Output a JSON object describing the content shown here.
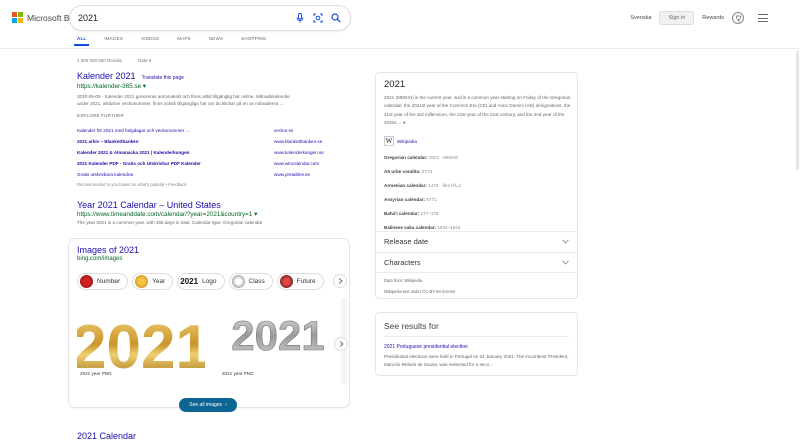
{
  "header": {
    "logo_text": "Microsoft Bing",
    "search_value": "2021",
    "language": "Svenska",
    "signin": "Sign in",
    "rewards": "Rewards"
  },
  "tabs": [
    "ALL",
    "IMAGES",
    "VIDEOS",
    "MAPS",
    "NEWS",
    "SHOPPING"
  ],
  "meta": {
    "results_count": "1 300 000 000 Results",
    "date_filter": "Date"
  },
  "result1": {
    "title": "Kalender 2021",
    "translate": "Translate this page",
    "url": "https://kalender-365.se",
    "snippet_line1": "2020-06-09 · Kalender 2021 genereras automatiskt och finns alltid tillgänglig här online. Månadskalender",
    "snippet_line2": "under 2021, inklusive veckonummer, finns också tillgängliga här om du klickar på en av månaderna ...",
    "explore_title": "EXPLORE FURTHER",
    "explore": [
      {
        "label": "Kalender för 2021 med helgdagar och veckonummer ...",
        "source": "veckor.se"
      },
      {
        "label": "2021 arkiv – Blankettbanken",
        "source": "www.blankettbanken.se"
      },
      {
        "label": "Kalender 2021 & Almanacka 2021 | Kalenderkungen",
        "source": "www.kalenderkungen.se"
      },
      {
        "label": "2021 Kalender PDF - Gratis och Utskrivbar PDF Kalender",
        "source": "www.wincalendar.com"
      },
      {
        "label": "Gratis utskrivbara kalendrar",
        "source": "www.pretables.se"
      }
    ],
    "recommended": "Recommended to you based on what's popular • Feedback"
  },
  "result2": {
    "title": "Year 2021 Calendar – United States",
    "url": "https://www.timeanddate.com/calendar/?year=2021&country=1",
    "snippet": "The year 2021 is a common year, with 365 days in total. Calendar type: Gregorian calendar"
  },
  "images": {
    "title": "Images of 2021",
    "url": "bing.com/images",
    "chips": [
      "Number",
      "Year",
      "Logo",
      "Class",
      "Future"
    ],
    "captions": [
      "2021 year PNG",
      "2021 year PNG"
    ],
    "thumb_text": "2021",
    "see_all": "See all images"
  },
  "result3": {
    "title": "2021 Calendar"
  },
  "knowledge": {
    "title": "2021",
    "body": "2021 (MMXXI) is the current year, and is a common year starting on Friday of the Gregorian calendar, the 2021st year of the Common Era (CE) and Anno Domini (AD) designations, the 21st year of the 3rd millennium, the 21st year of the 21st century, and the 2nd year of the 2020s ...",
    "source": "Wikipedia",
    "facts": [
      {
        "k": "Gregorian calendar:",
        "v": "2021 · MMXXI"
      },
      {
        "k": "Ab urbe condita:",
        "v": "2774"
      },
      {
        "k": "Armenian calendar:",
        "v": "1470 · ԹՎ ՌՆՀ"
      },
      {
        "k": "Assyrian calendar:",
        "v": "6771"
      },
      {
        "k": "Bahá'í calendar:",
        "v": "177–178"
      },
      {
        "k": "Balinese saka calendar:",
        "v": "1942–1943"
      }
    ],
    "expanders": [
      "Release date",
      "Characters"
    ],
    "data_from": "Data from: Wikipedia",
    "license": "Wikipedia text under CC-BY-SA license"
  },
  "see_results": {
    "title": "See results for",
    "link": "2021 Portuguese presidential election",
    "snippet": "Presidential elections were held in Portugal on 24 January 2021. The incumbent President, Marcelo Rebelo de Sousa, was reelected for a seco..."
  },
  "colors": {
    "link": "#1a0dab",
    "url": "#006621",
    "accent": "#174ae4",
    "see_all_bg": "#0c6593"
  }
}
